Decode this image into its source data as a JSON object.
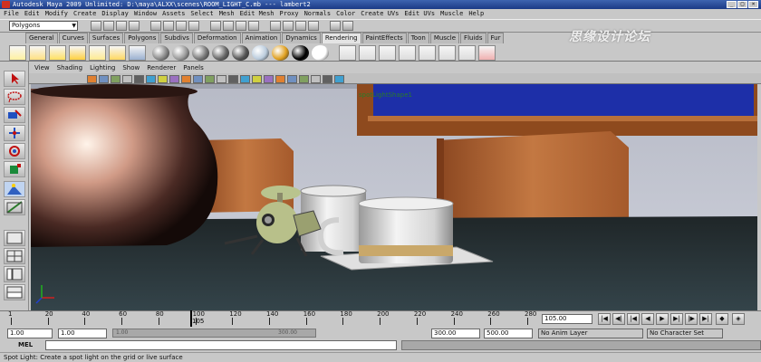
{
  "window": {
    "title": "Autodesk Maya 2009 Unlimited: D:\\maya\\ALXX\\scenes\\ROOM_LIGHT_C.mb   ---   lambert2",
    "controls": [
      "_",
      "□",
      "×"
    ]
  },
  "menubar": [
    "File",
    "Edit",
    "Modify",
    "Create",
    "Display",
    "Window",
    "Assets",
    "Select",
    "Mesh",
    "Edit Mesh",
    "Proxy",
    "Normals",
    "Color",
    "Create UVs",
    "Edit UVs",
    "Muscle",
    "Help"
  ],
  "status_line": {
    "mode": "Polygons"
  },
  "shelf": {
    "tabs": [
      "General",
      "Curves",
      "Surfaces",
      "Polygons",
      "Subdivs",
      "Deformation",
      "Animation",
      "Dynamics",
      "Rendering",
      "PaintEffects",
      "Toon",
      "Muscle",
      "Fluids",
      "Fur"
    ],
    "active_tab": "Rendering"
  },
  "panel": {
    "menu": [
      "View",
      "Shading",
      "Lighting",
      "Show",
      "Renderer",
      "Panels"
    ],
    "camera_overlay": "spotLightShape1"
  },
  "time_slider": {
    "ticks": [
      "1",
      "20",
      "40",
      "60",
      "80",
      "100",
      "120",
      "140",
      "160",
      "180",
      "200",
      "220",
      "240",
      "260",
      "280"
    ],
    "current_frame": "105",
    "current_time_field": "105.00"
  },
  "range_slider": {
    "start_time": "1.00",
    "playback_start": "1.00",
    "playback_end": "300.00",
    "end_time": "500.00",
    "slider_start_label": "1.00",
    "slider_end_label": "300.00",
    "anim_layer": "No Anim Layer",
    "character_set": "No Character Set"
  },
  "command_line": {
    "label": "MEL",
    "value": ""
  },
  "help_line": "Spot Light: Create a spot light on the grid or live surface",
  "watermark": "思缘设计论坛",
  "colors": {
    "ui_gray": "#c8c8c8",
    "title_blue": "#1b3a86",
    "viewport_wall": "#c4c7d2",
    "table_top": "#2f3a3c",
    "wood": "#b86a3a",
    "picture_blue": "#1d2fa8"
  }
}
